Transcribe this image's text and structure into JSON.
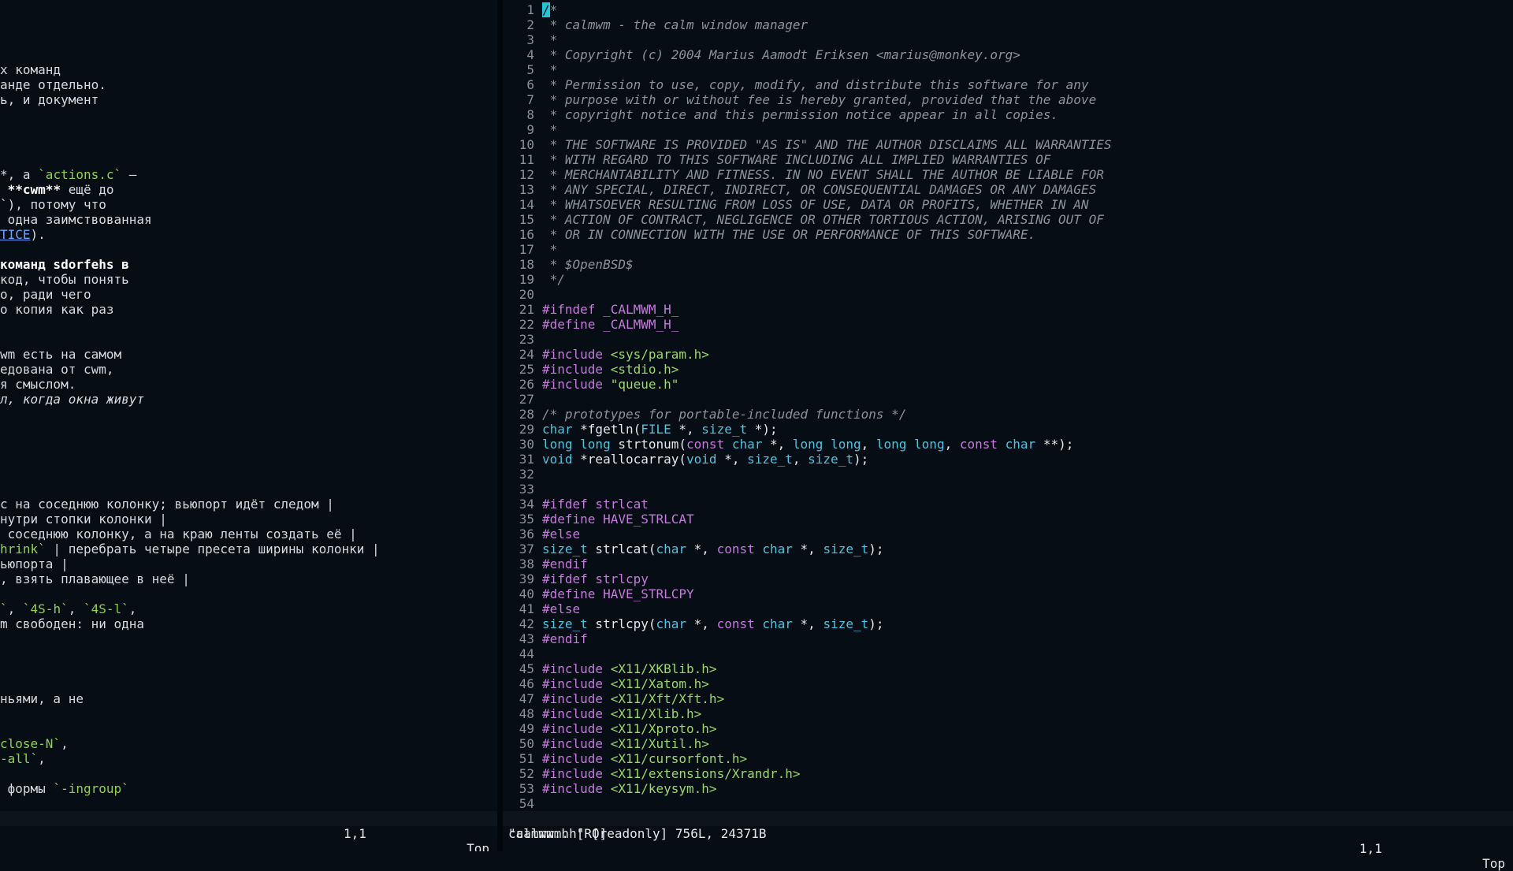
{
  "left_pane": {
    "lines": [
      [],
      [],
      [],
      [],
      [
        {
          "t": "х команд"
        }
      ],
      [
        {
          "t": "анде отдельно."
        }
      ],
      [
        {
          "t": "ь, и документ"
        }
      ],
      [],
      [],
      [],
      [],
      [
        {
          "t": "*, а "
        },
        {
          "t": "`actions.c`",
          "c": "code"
        },
        {
          "t": " —"
        }
      ],
      [
        {
          "t": " "
        },
        {
          "t": "**cwm**",
          "c": "bold"
        },
        {
          "t": " ещё до"
        }
      ],
      [
        {
          "t": "`), потому что"
        }
      ],
      [
        {
          "t": " одна заимствованная"
        }
      ],
      [
        {
          "t": "TICE",
          "c": "link"
        },
        {
          "t": ")."
        }
      ],
      [],
      [
        {
          "t": "команд sdorfehs в",
          "c": "bold"
        }
      ],
      [
        {
          "t": "код, чтобы понять"
        }
      ],
      [
        {
          "t": "о, ради чего"
        }
      ],
      [
        {
          "t": "о копия как раз"
        }
      ],
      [],
      [],
      [
        {
          "t": "wm есть на самом"
        }
      ],
      [
        {
          "t": "едована от cwm,"
        }
      ],
      [
        {
          "t": "я смыслом."
        }
      ],
      [
        {
          "t": "л, когда окна живут",
          "c": "ital"
        }
      ],
      [],
      [],
      [],
      [],
      [],
      [],
      [
        {
          "t": "с на соседнюю колонку; вьюпорт идёт следом |"
        }
      ],
      [
        {
          "t": "нутри стопки колонки |"
        }
      ],
      [
        {
          "t": " соседнюю колонку, а на краю ленты создать её |"
        }
      ],
      [
        {
          "t": "hrink`",
          "c": "code"
        },
        {
          "t": " | перебрать четыре пресета ширины колонки |"
        }
      ],
      [
        {
          "t": "ьюпорта |"
        }
      ],
      [
        {
          "t": ", взять плавающее в неё |"
        }
      ],
      [],
      [
        {
          "t": "`",
          "c": "code"
        },
        {
          "t": ", "
        },
        {
          "t": "`4S-h`",
          "c": "code"
        },
        {
          "t": ", "
        },
        {
          "t": "`4S-l`",
          "c": "code"
        },
        {
          "t": ","
        }
      ],
      [
        {
          "t": "m свободен: ни одна"
        }
      ],
      [],
      [],
      [],
      [],
      [
        {
          "t": "ньями, а не"
        }
      ],
      [],
      [],
      [
        {
          "t": "close-N`",
          "c": "code"
        },
        {
          "t": ","
        }
      ],
      [
        {
          "t": "-all`",
          "c": "code"
        },
        {
          "t": ","
        }
      ],
      [],
      [
        {
          "t": " формы "
        },
        {
          "t": "`-ingroup`",
          "c": "code"
        }
      ],
      []
    ],
    "status": {
      "position": "1,1",
      "scroll": "Top"
    }
  },
  "right_pane": {
    "lines": [
      {
        "n": "1",
        "s": [
          {
            "t": "/",
            "c": "cur"
          },
          {
            "t": "*",
            "c": "cm"
          }
        ]
      },
      {
        "n": "2",
        "s": [
          {
            "t": " * calmwm - the calm window manager",
            "c": "cm"
          }
        ]
      },
      {
        "n": "3",
        "s": [
          {
            "t": " *",
            "c": "cm"
          }
        ]
      },
      {
        "n": "4",
        "s": [
          {
            "t": " * Copyright (c) 2004 Marius Aamodt Eriksen <marius@monkey.org>",
            "c": "cm"
          }
        ]
      },
      {
        "n": "5",
        "s": [
          {
            "t": " *",
            "c": "cm"
          }
        ]
      },
      {
        "n": "6",
        "s": [
          {
            "t": " * Permission to use, copy, modify, and distribute this software for any",
            "c": "cm"
          }
        ]
      },
      {
        "n": "7",
        "s": [
          {
            "t": " * purpose with or without fee is hereby granted, provided that the above",
            "c": "cm"
          }
        ]
      },
      {
        "n": "8",
        "s": [
          {
            "t": " * copyright notice and this permission notice appear in all copies.",
            "c": "cm"
          }
        ]
      },
      {
        "n": "9",
        "s": [
          {
            "t": " *",
            "c": "cm"
          }
        ]
      },
      {
        "n": "10",
        "s": [
          {
            "t": " * THE SOFTWARE IS PROVIDED \"AS IS\" AND THE AUTHOR DISCLAIMS ALL WARRANTIES",
            "c": "cm"
          }
        ]
      },
      {
        "n": "11",
        "s": [
          {
            "t": " * WITH REGARD TO THIS SOFTWARE INCLUDING ALL IMPLIED WARRANTIES OF",
            "c": "cm"
          }
        ]
      },
      {
        "n": "12",
        "s": [
          {
            "t": " * MERCHANTABILITY AND FITNESS. IN NO EVENT SHALL THE AUTHOR BE LIABLE FOR",
            "c": "cm"
          }
        ]
      },
      {
        "n": "13",
        "s": [
          {
            "t": " * ANY SPECIAL, DIRECT, INDIRECT, OR CONSEQUENTIAL DAMAGES OR ANY DAMAGES",
            "c": "cm"
          }
        ]
      },
      {
        "n": "14",
        "s": [
          {
            "t": " * WHATSOEVER RESULTING FROM LOSS OF USE, DATA OR PROFITS, WHETHER IN AN",
            "c": "cm"
          }
        ]
      },
      {
        "n": "15",
        "s": [
          {
            "t": " * ACTION OF CONTRACT, NEGLIGENCE OR OTHER TORTIOUS ACTION, ARISING OUT OF",
            "c": "cm"
          }
        ]
      },
      {
        "n": "16",
        "s": [
          {
            "t": " * OR IN CONNECTION WITH THE USE OR PERFORMANCE OF THIS SOFTWARE.",
            "c": "cm"
          }
        ]
      },
      {
        "n": "17",
        "s": [
          {
            "t": " *",
            "c": "cm"
          }
        ]
      },
      {
        "n": "18",
        "s": [
          {
            "t": " * $OpenBSD$",
            "c": "cm"
          }
        ]
      },
      {
        "n": "19",
        "s": [
          {
            "t": " */",
            "c": "cm"
          }
        ]
      },
      {
        "n": "20",
        "s": []
      },
      {
        "n": "21",
        "s": [
          {
            "t": "#ifndef _CALMWM_H_",
            "c": "pp"
          }
        ]
      },
      {
        "n": "22",
        "s": [
          {
            "t": "#define _CALMWM_H_",
            "c": "pp"
          }
        ]
      },
      {
        "n": "23",
        "s": []
      },
      {
        "n": "24",
        "s": [
          {
            "t": "#include ",
            "c": "pp"
          },
          {
            "t": "<sys/param.h>",
            "c": "inc"
          }
        ]
      },
      {
        "n": "25",
        "s": [
          {
            "t": "#include ",
            "c": "pp"
          },
          {
            "t": "<stdio.h>",
            "c": "inc"
          }
        ]
      },
      {
        "n": "26",
        "s": [
          {
            "t": "#include ",
            "c": "pp"
          },
          {
            "t": "\"queue.h\"",
            "c": "inc"
          }
        ]
      },
      {
        "n": "27",
        "s": []
      },
      {
        "n": "28",
        "s": [
          {
            "t": "/* prototypes for portable-included functions */",
            "c": "cm"
          }
        ]
      },
      {
        "n": "29",
        "s": [
          {
            "t": "char",
            "c": "ty"
          },
          {
            "t": " *fgetln("
          },
          {
            "t": "FILE",
            "c": "ty"
          },
          {
            "t": " *, "
          },
          {
            "t": "size_t",
            "c": "ty"
          },
          {
            "t": " *);"
          }
        ]
      },
      {
        "n": "30",
        "s": [
          {
            "t": "long long",
            "c": "ty"
          },
          {
            "t": " strtonum("
          },
          {
            "t": "const",
            "c": "kw"
          },
          {
            "t": " "
          },
          {
            "t": "char",
            "c": "ty"
          },
          {
            "t": " *, "
          },
          {
            "t": "long long",
            "c": "ty"
          },
          {
            "t": ", "
          },
          {
            "t": "long long",
            "c": "ty"
          },
          {
            "t": ", "
          },
          {
            "t": "const",
            "c": "kw"
          },
          {
            "t": " "
          },
          {
            "t": "char",
            "c": "ty"
          },
          {
            "t": " **);"
          }
        ]
      },
      {
        "n": "31",
        "s": [
          {
            "t": "void",
            "c": "ty"
          },
          {
            "t": " *reallocarray("
          },
          {
            "t": "void",
            "c": "ty"
          },
          {
            "t": " *, "
          },
          {
            "t": "size_t",
            "c": "ty"
          },
          {
            "t": ", "
          },
          {
            "t": "size_t",
            "c": "ty"
          },
          {
            "t": ");"
          }
        ]
      },
      {
        "n": "32",
        "s": []
      },
      {
        "n": "33",
        "s": []
      },
      {
        "n": "34",
        "s": [
          {
            "t": "#ifdef strlcat",
            "c": "pp"
          }
        ]
      },
      {
        "n": "35",
        "s": [
          {
            "t": "#define HAVE_STRLCAT",
            "c": "pp"
          }
        ]
      },
      {
        "n": "36",
        "s": [
          {
            "t": "#else",
            "c": "pp"
          }
        ]
      },
      {
        "n": "37",
        "s": [
          {
            "t": "size_t",
            "c": "ty"
          },
          {
            "t": " strlcat("
          },
          {
            "t": "char",
            "c": "ty"
          },
          {
            "t": " *, "
          },
          {
            "t": "const",
            "c": "kw"
          },
          {
            "t": " "
          },
          {
            "t": "char",
            "c": "ty"
          },
          {
            "t": " *, "
          },
          {
            "t": "size_t",
            "c": "ty"
          },
          {
            "t": ");"
          }
        ]
      },
      {
        "n": "38",
        "s": [
          {
            "t": "#endif",
            "c": "pp"
          }
        ]
      },
      {
        "n": "39",
        "s": [
          {
            "t": "#ifdef strlcpy",
            "c": "pp"
          }
        ]
      },
      {
        "n": "40",
        "s": [
          {
            "t": "#define HAVE_STRLCPY",
            "c": "pp"
          }
        ]
      },
      {
        "n": "41",
        "s": [
          {
            "t": "#else",
            "c": "pp"
          }
        ]
      },
      {
        "n": "42",
        "s": [
          {
            "t": "size_t",
            "c": "ty"
          },
          {
            "t": " strlcpy("
          },
          {
            "t": "char",
            "c": "ty"
          },
          {
            "t": " *, "
          },
          {
            "t": "const",
            "c": "kw"
          },
          {
            "t": " "
          },
          {
            "t": "char",
            "c": "ty"
          },
          {
            "t": " *, "
          },
          {
            "t": "size_t",
            "c": "ty"
          },
          {
            "t": ");"
          }
        ]
      },
      {
        "n": "43",
        "s": [
          {
            "t": "#endif",
            "c": "pp"
          }
        ]
      },
      {
        "n": "44",
        "s": []
      },
      {
        "n": "45",
        "s": [
          {
            "t": "#include ",
            "c": "pp"
          },
          {
            "t": "<X11/XKBlib.h>",
            "c": "inc"
          }
        ]
      },
      {
        "n": "46",
        "s": [
          {
            "t": "#include ",
            "c": "pp"
          },
          {
            "t": "<X11/Xatom.h>",
            "c": "inc"
          }
        ]
      },
      {
        "n": "47",
        "s": [
          {
            "t": "#include ",
            "c": "pp"
          },
          {
            "t": "<X11/Xft/Xft.h>",
            "c": "inc"
          }
        ]
      },
      {
        "n": "48",
        "s": [
          {
            "t": "#include ",
            "c": "pp"
          },
          {
            "t": "<X11/Xlib.h>",
            "c": "inc"
          }
        ]
      },
      {
        "n": "49",
        "s": [
          {
            "t": "#include ",
            "c": "pp"
          },
          {
            "t": "<X11/Xproto.h>",
            "c": "inc"
          }
        ]
      },
      {
        "n": "50",
        "s": [
          {
            "t": "#include ",
            "c": "pp"
          },
          {
            "t": "<X11/Xutil.h>",
            "c": "inc"
          }
        ]
      },
      {
        "n": "51",
        "s": [
          {
            "t": "#include ",
            "c": "pp"
          },
          {
            "t": "<X11/cursorfont.h>",
            "c": "inc"
          }
        ]
      },
      {
        "n": "52",
        "s": [
          {
            "t": "#include ",
            "c": "pp"
          },
          {
            "t": "<X11/extensions/Xrandr.h>",
            "c": "inc"
          }
        ]
      },
      {
        "n": "53",
        "s": [
          {
            "t": "#include ",
            "c": "pp"
          },
          {
            "t": "<X11/keysym.h>",
            "c": "inc"
          }
        ]
      },
      {
        "n": "54",
        "s": []
      }
    ],
    "status": {
      "file": "calmwm.h [RO]",
      "position": "1,1",
      "scroll": "Top"
    },
    "cmdline": "\"calmwm.h\" [readonly] 756L, 24371B"
  }
}
